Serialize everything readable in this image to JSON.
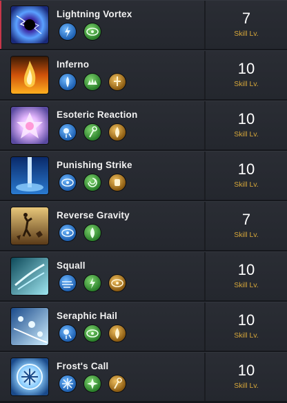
{
  "skills": [
    {
      "name": "Lightning Vortex",
      "level": "7",
      "level_label": "Skill Lv.",
      "icon": "lightning-vortex-icon",
      "tripods": [
        {
          "icon": "lightning-tripod-icon",
          "color": "blue"
        },
        {
          "icon": "range-tripod-icon",
          "color": "green"
        }
      ]
    },
    {
      "name": "Inferno",
      "level": "10",
      "level_label": "Skill Lv.",
      "icon": "inferno-icon",
      "tripods": [
        {
          "icon": "fire-pillar-tripod-icon",
          "color": "blue"
        },
        {
          "icon": "ground-flame-tripod-icon",
          "color": "green"
        },
        {
          "icon": "sword-tripod-icon",
          "color": "gold"
        }
      ]
    },
    {
      "name": "Esoteric Reaction",
      "level": "10",
      "level_label": "Skill Lv.",
      "icon": "esoteric-reaction-icon",
      "tripods": [
        {
          "icon": "orb-tripod-icon",
          "color": "blue"
        },
        {
          "icon": "staff-tripod-icon",
          "color": "green"
        },
        {
          "icon": "flame-tripod-icon",
          "color": "gold"
        }
      ]
    },
    {
      "name": "Punishing Strike",
      "level": "10",
      "level_label": "Skill Lv.",
      "icon": "punishing-strike-icon",
      "tripods": [
        {
          "icon": "range-tripod-icon",
          "color": "blue"
        },
        {
          "icon": "swirl-tripod-icon",
          "color": "green"
        },
        {
          "icon": "power-tripod-icon",
          "color": "gold"
        }
      ]
    },
    {
      "name": "Reverse Gravity",
      "level": "7",
      "level_label": "Skill Lv.",
      "icon": "reverse-gravity-icon",
      "tripods": [
        {
          "icon": "range-tripod-icon",
          "color": "blue"
        },
        {
          "icon": "fire-tripod-icon",
          "color": "green"
        }
      ]
    },
    {
      "name": "Squall",
      "level": "10",
      "level_label": "Skill Lv.",
      "icon": "squall-icon",
      "tripods": [
        {
          "icon": "wind-tripod-icon",
          "color": "blue"
        },
        {
          "icon": "lightning-tripod-icon",
          "color": "green"
        },
        {
          "icon": "range-tripod-icon",
          "color": "gold"
        }
      ]
    },
    {
      "name": "Seraphic Hail",
      "level": "10",
      "level_label": "Skill Lv.",
      "icon": "seraphic-hail-icon",
      "tripods": [
        {
          "icon": "orb-tripod-icon",
          "color": "blue"
        },
        {
          "icon": "range-tripod-icon",
          "color": "green"
        },
        {
          "icon": "fire-tripod-icon",
          "color": "gold"
        }
      ]
    },
    {
      "name": "Frost's Call",
      "level": "10",
      "level_label": "Skill Lv.",
      "icon": "frosts-call-icon",
      "tripods": [
        {
          "icon": "frost-tripod-icon",
          "color": "blue"
        },
        {
          "icon": "burst-tripod-icon",
          "color": "green"
        },
        {
          "icon": "staff-tripod-icon",
          "color": "gold"
        }
      ]
    }
  ],
  "tripod_colors": {
    "blue": "#2f7fd0",
    "green": "#3a9a3a",
    "gold": "#c28a1e"
  },
  "active_accent": "#c8364a"
}
